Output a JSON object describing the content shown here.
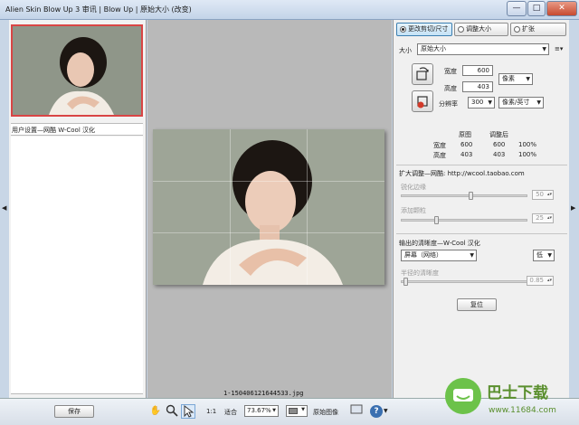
{
  "window": {
    "title": "Alien Skin Blow Up 3 审讯 | Blow Up | 原始大小 (改变)",
    "min": "—",
    "max": "□",
    "close": "✕"
  },
  "left": {
    "preset_label": "用户设置—网酷 W-Cool 汉化"
  },
  "canvas": {
    "filename": "1-150406121644533.jpg"
  },
  "tabs": [
    {
      "label": "更改剪切/尺寸",
      "active": true
    },
    {
      "label": "调整大小",
      "active": false
    },
    {
      "label": "扩张",
      "active": false
    }
  ],
  "size": {
    "label": "大小",
    "preset": "原始大小",
    "menu_icon": "≡▾",
    "width_label": "宽度",
    "width_value": "600",
    "height_label": "高度",
    "height_value": "403",
    "unit": "像素",
    "resolution_label": "分辨率",
    "resolution_value": "300",
    "resolution_unit": "像素/英寸"
  },
  "table": {
    "col_original": "原图",
    "col_adjusted": "调整后",
    "rows": [
      {
        "label": "宽度",
        "original": "600",
        "adjusted": "600",
        "percent": "100%"
      },
      {
        "label": "高度",
        "original": "403",
        "adjusted": "403",
        "percent": "100%"
      }
    ]
  },
  "enlarge": {
    "header": "扩大调整—网酷: http://wcool.taobao.com",
    "sharpen_label": "锐化边缘",
    "sharpen_value": "50",
    "sharpen_level": 0.55,
    "grain_label": "添加颗粒",
    "grain_value": "25",
    "grain_level": 0.27
  },
  "output": {
    "header": "输出的清晰度—W-Cool 汉化",
    "device": "屏幕（网络）",
    "level": "低",
    "radius_label": "半径的清晰度",
    "radius_value": "0.85",
    "radius_level": 0.02,
    "reset_label": "复位"
  },
  "bottom": {
    "save_label": "保存",
    "ratio_label": "1:1",
    "fit_label": "适合",
    "zoom": "73.67%",
    "original_label": "原始图像",
    "help": "?"
  },
  "watermark": {
    "text": "巴士下载",
    "url": "www.11684.com"
  }
}
